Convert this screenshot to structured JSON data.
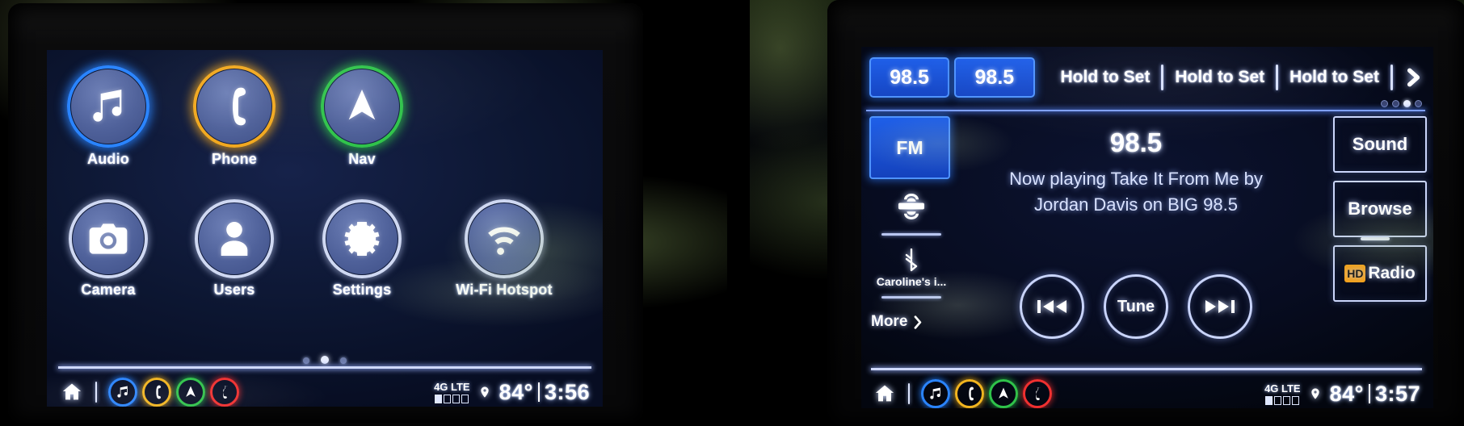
{
  "left_screen": {
    "name": "home-screen",
    "apps": [
      {
        "label": "Audio",
        "icon": "music-note-icon",
        "ring": "blue"
      },
      {
        "label": "Phone",
        "icon": "phone-icon",
        "ring": "amber"
      },
      {
        "label": "Nav",
        "icon": "navigation-arrow-icon",
        "ring": "green"
      },
      {
        "label": "Camera",
        "icon": "camera-icon",
        "ring": "white"
      },
      {
        "label": "Users",
        "icon": "user-icon",
        "ring": "white"
      },
      {
        "label": "Settings",
        "icon": "gear-icon",
        "ring": "white"
      },
      {
        "label": "Wi-Fi Hotspot",
        "icon": "wifi-icon",
        "ring": "white"
      }
    ],
    "page_dots": {
      "count": 3,
      "active_index": 1
    },
    "status_bar": {
      "home_icon": "home-icon",
      "shortcuts": [
        {
          "name": "audio-shortcut",
          "icon": "music-note-icon",
          "ring": "blue"
        },
        {
          "name": "phone-shortcut",
          "icon": "phone-icon",
          "ring": "amber"
        },
        {
          "name": "nav-shortcut",
          "icon": "navigation-arrow-icon",
          "ring": "green"
        },
        {
          "name": "onstar-shortcut",
          "icon": "onstar-icon",
          "ring": "red"
        }
      ],
      "network_label": "4G LTE",
      "signal_bars_filled": 1,
      "signal_bars_total": 4,
      "location_icon": "location-pin-icon",
      "temperature": "84°",
      "time": "3:56"
    }
  },
  "right_screen": {
    "name": "fm-radio-screen",
    "presets": [
      {
        "label": "98.5",
        "active": true
      },
      {
        "label": "98.5",
        "active": true
      },
      {
        "label": "Hold to Set",
        "active": false
      },
      {
        "label": "Hold to Set",
        "active": false
      },
      {
        "label": "Hold to Set",
        "active": false
      }
    ],
    "preset_next_icon": "chevron-right-icon",
    "preset_page_dots": {
      "count": 4,
      "active_index": 2
    },
    "sources": [
      {
        "label": "FM",
        "icon": "fm-icon",
        "active": true
      },
      {
        "label": "",
        "icon": "satellite-radio-icon",
        "active": false
      },
      {
        "label": "Caroline's i...",
        "icon": "bluetooth-icon",
        "active": false
      }
    ],
    "more_label": "More",
    "more_icon": "chevron-right-icon",
    "now_playing": {
      "frequency": "98.5",
      "line1": "Now playing Take It From Me by",
      "line2": "Jordan Davis on BIG 98.5"
    },
    "transport": [
      {
        "name": "previous-button",
        "icon": "skip-back-icon",
        "label": ""
      },
      {
        "name": "tune-button",
        "icon": "",
        "label": "Tune"
      },
      {
        "name": "next-button",
        "icon": "skip-forward-icon",
        "label": ""
      }
    ],
    "side_buttons": [
      {
        "label": "Sound",
        "name": "sound-button"
      },
      {
        "label": "Browse",
        "name": "browse-button"
      },
      {
        "label": "Radio",
        "name": "hd-radio-button",
        "badge": "HD"
      }
    ],
    "status_bar": {
      "home_icon": "home-icon",
      "shortcuts": [
        {
          "name": "audio-shortcut",
          "icon": "music-note-icon",
          "ring": "blue"
        },
        {
          "name": "phone-shortcut",
          "icon": "phone-icon",
          "ring": "amber"
        },
        {
          "name": "nav-shortcut",
          "icon": "navigation-arrow-icon",
          "ring": "green"
        },
        {
          "name": "onstar-shortcut",
          "icon": "onstar-icon",
          "ring": "red"
        }
      ],
      "network_label": "4G LTE",
      "signal_bars_filled": 1,
      "signal_bars_total": 4,
      "location_icon": "location-pin-icon",
      "temperature": "84°",
      "time": "3:57"
    }
  },
  "colors": {
    "accent_blue": "#1f5fe8",
    "ring_blue": "#2a84ff",
    "ring_amber": "#f1a81f",
    "ring_green": "#2fc34a",
    "ring_red": "#f03030",
    "hd_orange": "#f2a01a",
    "text_white": "#ffffff"
  }
}
